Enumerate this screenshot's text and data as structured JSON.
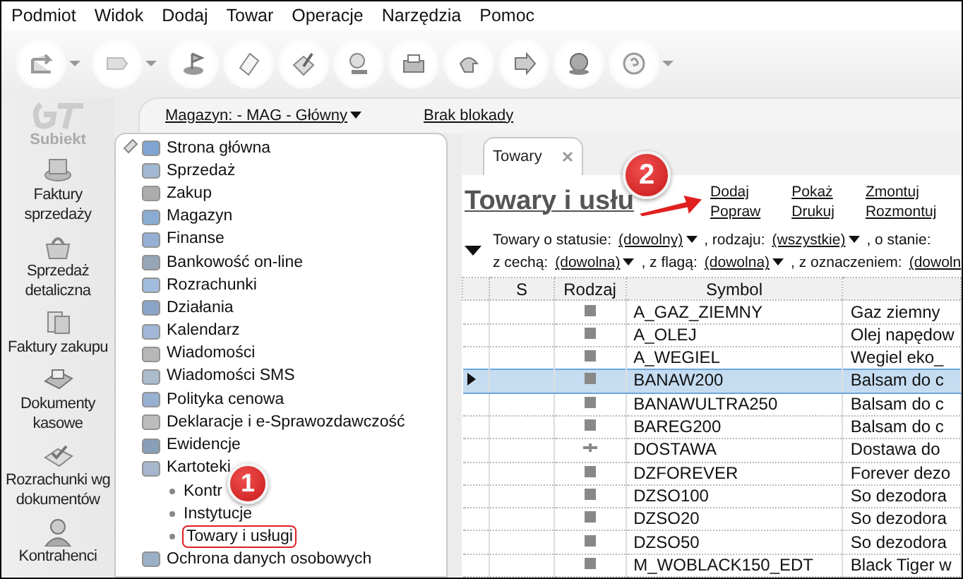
{
  "menu": [
    "Podmiot",
    "Widok",
    "Dodaj",
    "Towar",
    "Operacje",
    "Narzędzia",
    "Pomoc"
  ],
  "toolbar": [
    {
      "dropdown": true
    },
    {
      "dropdown": true
    },
    {
      "dropdown": false
    },
    {
      "dropdown": false
    },
    {
      "dropdown": false
    },
    {
      "dropdown": false
    },
    {
      "dropdown": false
    },
    {
      "dropdown": false
    },
    {
      "dropdown": false
    },
    {
      "dropdown": false
    },
    {
      "dropdown": true
    }
  ],
  "logo": "Subiekt",
  "shortcuts": [
    "Faktury sprzedaży",
    "Sprzedaż detaliczna",
    "Faktury zakupu",
    "Dokumenty kasowe",
    "Rozrachunki wg dokumentów",
    "Kontrahenci"
  ],
  "context_bar": {
    "warehouse": "Magazyn: - MAG - Główny",
    "lock": "Brak blokady"
  },
  "nav_tree": [
    {
      "label": "Strona główna"
    },
    {
      "label": "Sprzedaż"
    },
    {
      "label": "Zakup"
    },
    {
      "label": "Magazyn"
    },
    {
      "label": "Finanse"
    },
    {
      "label": "Bankowość on-line"
    },
    {
      "label": "Rozrachunki"
    },
    {
      "label": "Działania"
    },
    {
      "label": "Kalendarz"
    },
    {
      "label": "Wiadomości"
    },
    {
      "label": "Wiadomości SMS"
    },
    {
      "label": "Polityka cenowa"
    },
    {
      "label": "Deklaracje i e-Sprawozdawczość"
    },
    {
      "label": "Ewidencje"
    },
    {
      "label": "Kartoteki",
      "expanded": true,
      "children": [
        {
          "label": "Kontr",
          "highlighted": false
        },
        {
          "label": "Instytucje",
          "highlighted": false
        },
        {
          "label": "Towary i usługi",
          "highlighted": true
        }
      ]
    },
    {
      "label": "Ochrona danych osobowych"
    }
  ],
  "tabs": [
    {
      "label": "Towary",
      "selected": true
    }
  ],
  "page_title": "Towary i usłu",
  "actions": [
    [
      "Dodaj",
      "Popraw"
    ],
    [
      "Pokaż",
      "Drukuj"
    ],
    [
      "Zmontuj",
      "Rozmontuj"
    ]
  ],
  "filters": [
    [
      {
        "kind": "label",
        "text": "Towary o statusie:"
      },
      {
        "kind": "dropdown",
        "text": "(dowolny)"
      },
      {
        "kind": "label",
        "text": ", rodzaju:"
      },
      {
        "kind": "dropdown",
        "text": "(wszystkie)"
      },
      {
        "kind": "label",
        "text": ", o stanie:"
      }
    ],
    [
      {
        "kind": "label",
        "text": "z cechą:"
      },
      {
        "kind": "dropdown",
        "text": "(dowolna)"
      },
      {
        "kind": "label",
        "text": ", z flagą:"
      },
      {
        "kind": "dropdown",
        "text": "(dowolna)"
      },
      {
        "kind": "label",
        "text": ", z oznaczeniem:"
      },
      {
        "kind": "link",
        "text": "(dowoln"
      }
    ]
  ],
  "table": {
    "columns": [
      "S",
      "Rodzaj",
      "Symbol"
    ],
    "rows": [
      {
        "kind": "goods",
        "symbol": "A_GAZ_ZIEMNY",
        "column_4": "Gaz ziemny",
        "selected": false
      },
      {
        "kind": "goods",
        "symbol": "A_OLEJ",
        "column_4": "Olej napędow",
        "selected": false
      },
      {
        "kind": "goods",
        "symbol": "A_WEGIEL",
        "column_4": "Wegiel eko_",
        "selected": false
      },
      {
        "kind": "goods",
        "symbol": "BANAW200",
        "column_4": "Balsam do c",
        "selected": true
      },
      {
        "kind": "goods",
        "symbol": "BANAWULTRA250",
        "column_4": "Balsam do c",
        "selected": false
      },
      {
        "kind": "goods",
        "symbol": "BAREG200",
        "column_4": "Balsam do c",
        "selected": false
      },
      {
        "kind": "service",
        "symbol": "DOSTAWA",
        "column_4": "Dostawa do",
        "selected": false
      },
      {
        "kind": "goods",
        "symbol": "DZFOREVER",
        "column_4": "Forever dezo",
        "selected": false
      },
      {
        "kind": "goods",
        "symbol": "DZSO100",
        "column_4": "So dezodora",
        "selected": false
      },
      {
        "kind": "goods",
        "symbol": "DZSO20",
        "column_4": "So dezodora",
        "selected": false
      },
      {
        "kind": "goods",
        "symbol": "DZSO50",
        "column_4": "So dezodora",
        "selected": false
      },
      {
        "kind": "goods",
        "symbol": "M_WOBLACK150_EDT",
        "column_4": "Black Tiger w",
        "selected": false
      }
    ]
  },
  "callouts": [
    "1",
    "2"
  ]
}
